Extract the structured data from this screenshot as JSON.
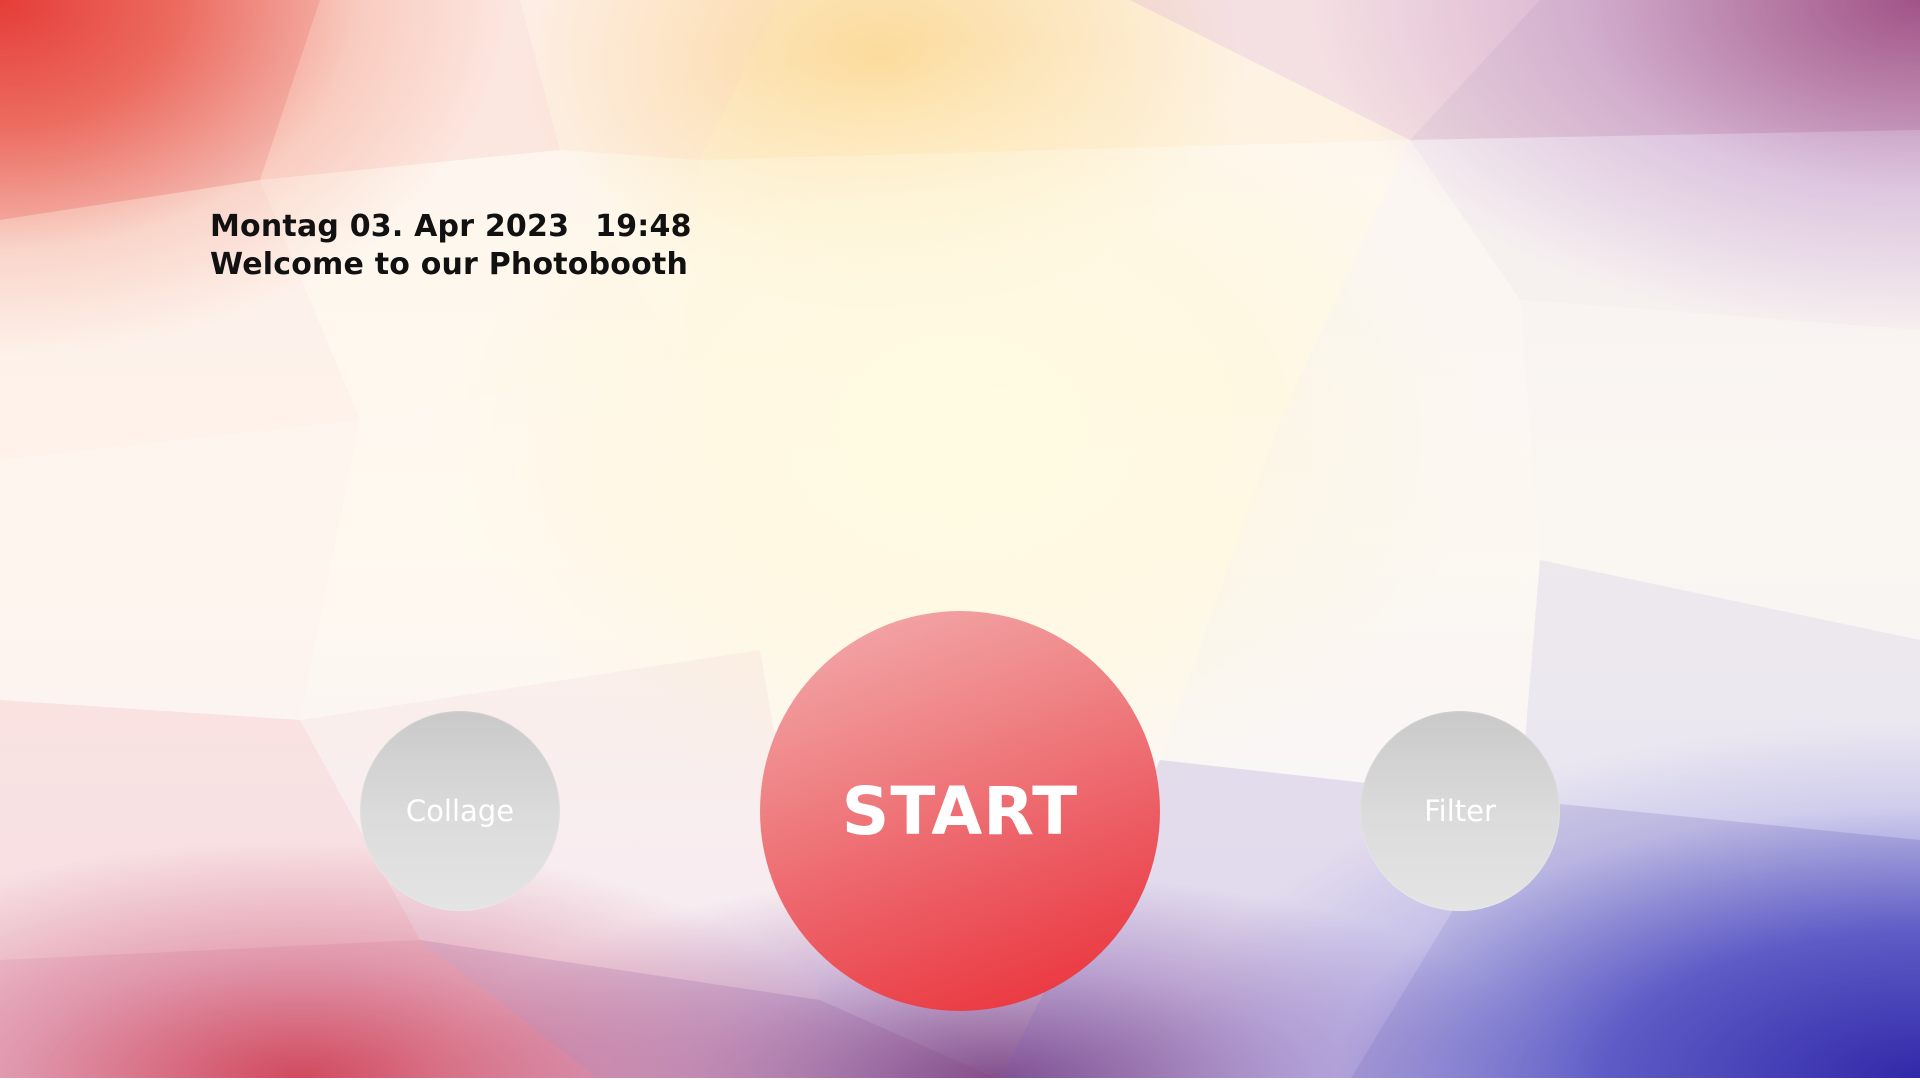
{
  "header": {
    "date": "Montag 03. Apr 2023",
    "time": "19:48",
    "welcome": "Welcome to our Photobooth"
  },
  "buttons": {
    "collage_label": "Collage",
    "start_label": "START",
    "filter_label": "Filter"
  },
  "colors": {
    "start_button": "#ec4a52",
    "side_buttons": "#d3d3d3",
    "text": "#111111"
  }
}
